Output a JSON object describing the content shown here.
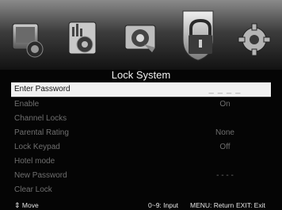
{
  "menu_tabs": [
    {
      "icon": "picture-icon"
    },
    {
      "icon": "sound-icon"
    },
    {
      "icon": "channel-icon"
    },
    {
      "icon": "lock-icon",
      "active": true
    },
    {
      "icon": "settings-icon"
    }
  ],
  "title": "Lock System",
  "items": [
    {
      "label": "Enter Password",
      "value": "_ _ _ _"
    },
    {
      "label": "Enable",
      "value": "On"
    },
    {
      "label": "Channel Locks",
      "value": ""
    },
    {
      "label": "Parental Rating",
      "value": "None"
    },
    {
      "label": "Lock Keypad",
      "value": "Off"
    },
    {
      "label": "Hotel mode",
      "value": ""
    },
    {
      "label": "New Password",
      "value": "- - - -"
    },
    {
      "label": "Clear Lock",
      "value": ""
    }
  ],
  "help": {
    "move_icon": "⇕",
    "move": "Move",
    "input": "0~9: Input",
    "return": "MENU: Return",
    "exit": "EXIT: Exit"
  },
  "colors": {
    "selected_bg": "#f1f1f1",
    "text_dim": "#6f6f6f"
  }
}
